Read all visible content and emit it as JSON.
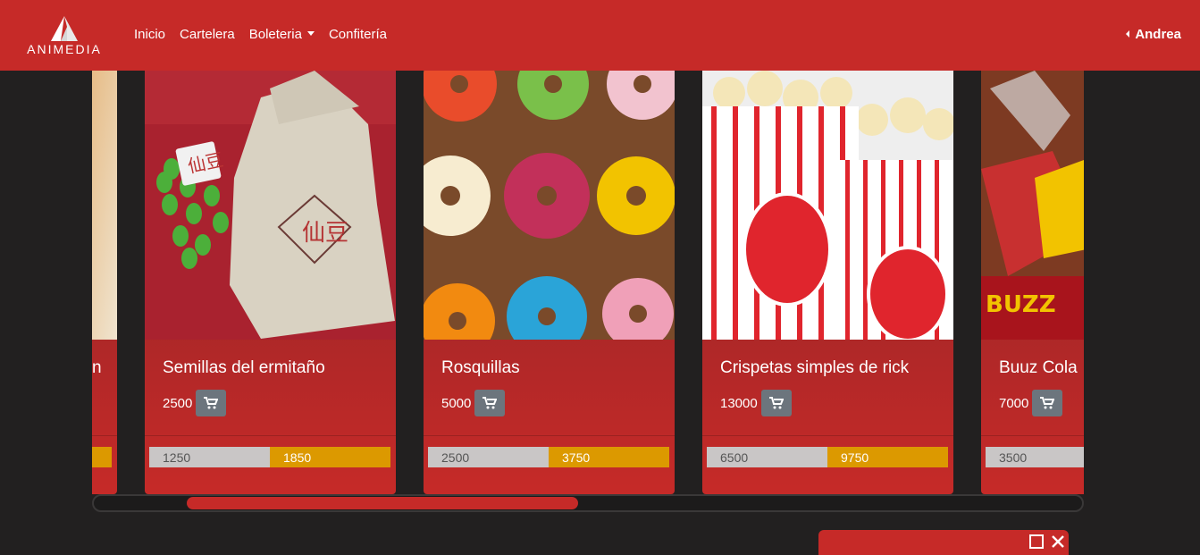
{
  "brand": {
    "name": "ANIMEDIA"
  },
  "nav": {
    "links": [
      {
        "label": "Inicio"
      },
      {
        "label": "Cartelera"
      },
      {
        "label": "Boleteria"
      },
      {
        "label": "Confitería"
      }
    ],
    "user": "Andrea"
  },
  "products": [
    {
      "name": "...n",
      "price": "",
      "low": "",
      "high": ""
    },
    {
      "name": "Semillas del ermitaño",
      "price": "2500",
      "low": "1250",
      "high": "1850"
    },
    {
      "name": "Rosquillas",
      "price": "5000",
      "low": "2500",
      "high": "3750"
    },
    {
      "name": "Crispetas simples de rick",
      "price": "13000",
      "low": "6500",
      "high": "9750"
    },
    {
      "name": "Buuz Cola",
      "price": "7000",
      "low": "3500",
      "high": ""
    }
  ],
  "icons": {
    "cart": "cart-icon",
    "maximize": "square-icon",
    "close": "close-icon"
  },
  "colors": {
    "brand_red": "#c62a28",
    "bar_gold": "#dc9900",
    "bar_gray": "#c9c6c6",
    "button_gray": "#6c757d"
  },
  "scroll": {
    "position_fraction": 0.09
  }
}
